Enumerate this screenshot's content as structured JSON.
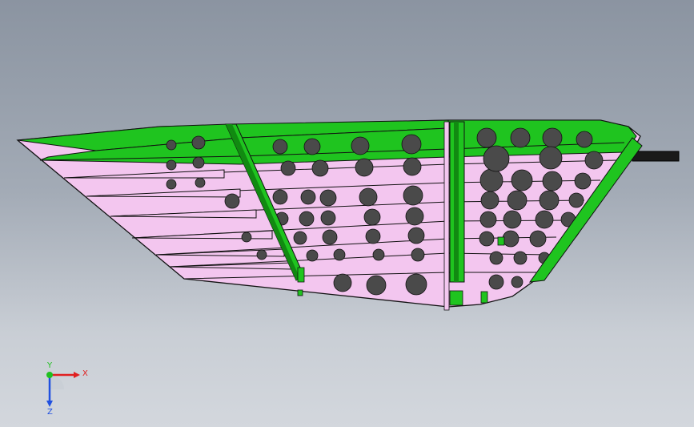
{
  "viewport": {
    "colors": {
      "rib": "#f3c6ef",
      "spar": "#1fc41f",
      "spar_dark": "#118a11",
      "edge": "#111111",
      "hole": "#4a4a4a",
      "rod": "#1a1a1a"
    }
  },
  "triad": {
    "x_label": "X",
    "y_label": "Y",
    "z_label": "Z",
    "colors": {
      "x": "#e02020",
      "y": "#20c020",
      "z": "#2050e0"
    }
  }
}
